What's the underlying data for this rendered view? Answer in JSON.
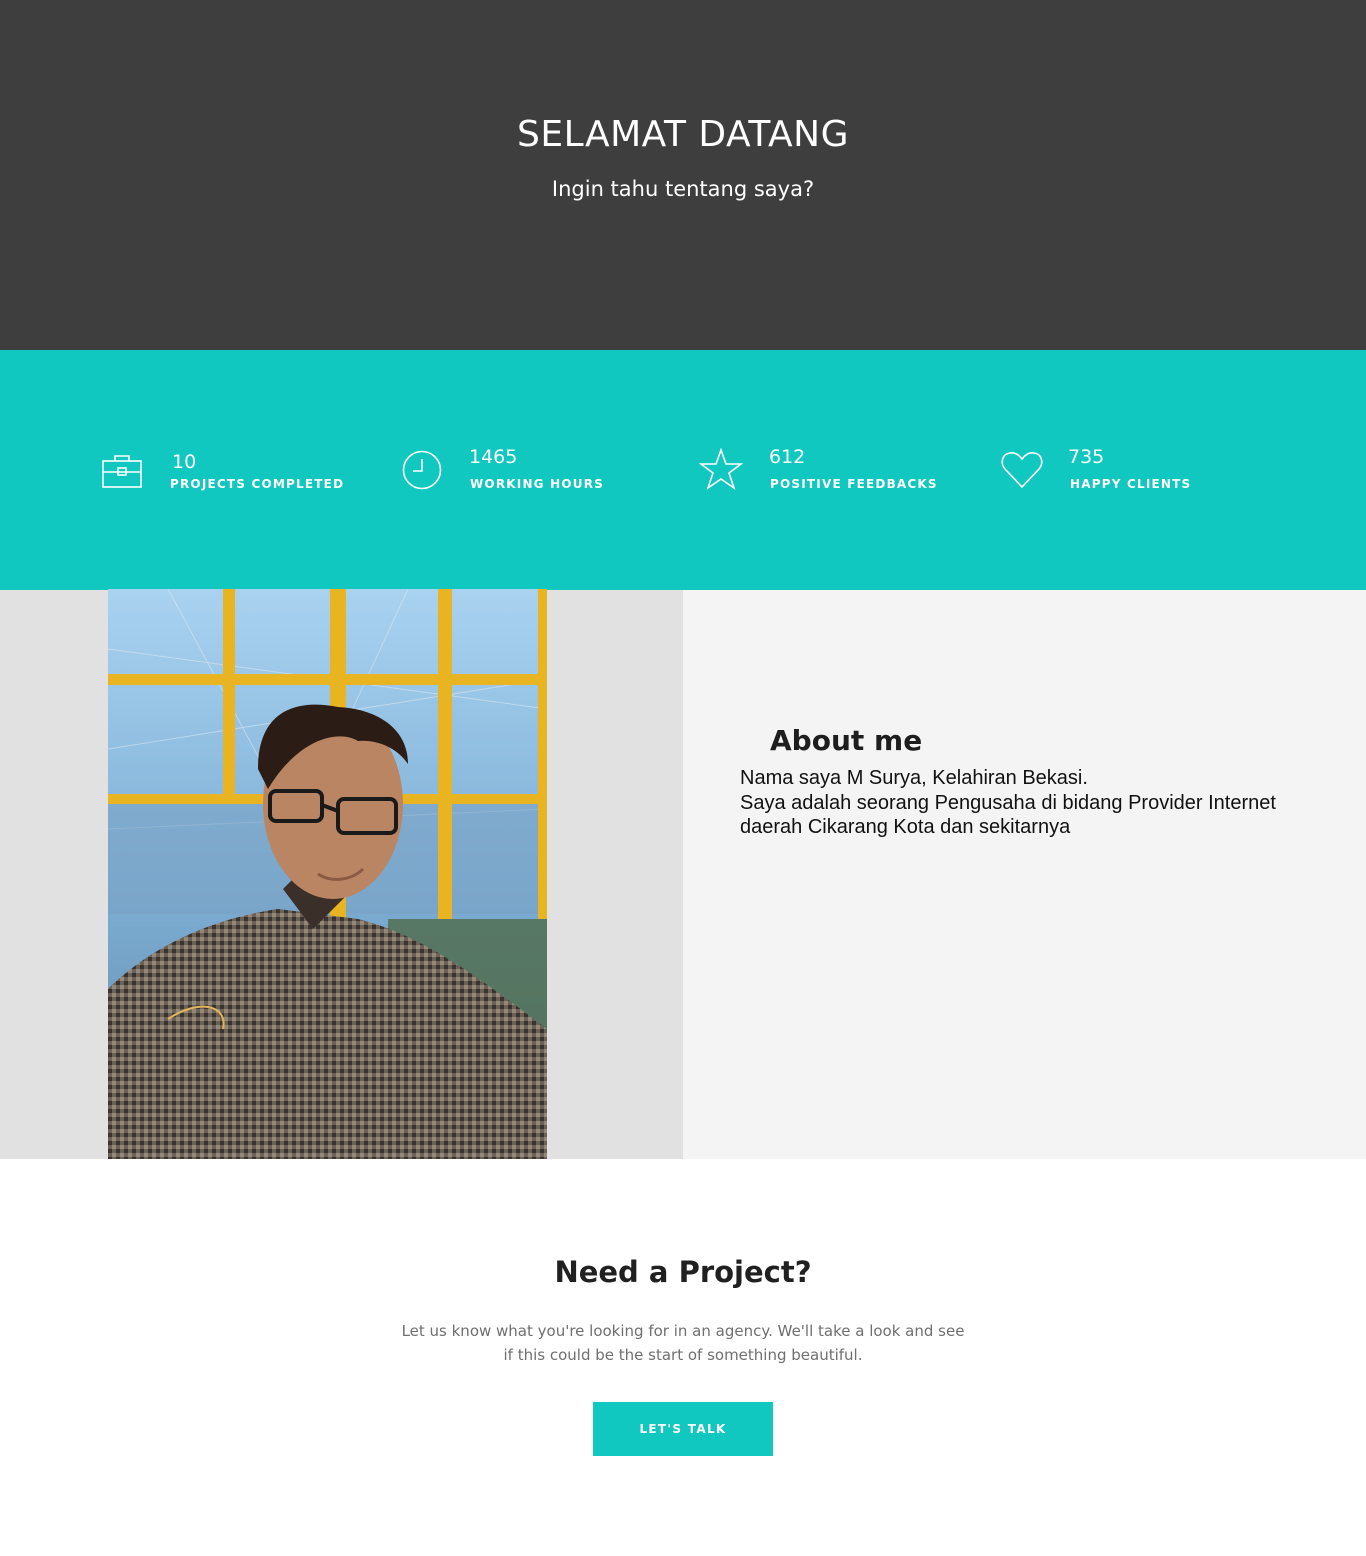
{
  "hero": {
    "title": "SELAMAT DATANG",
    "subtitle": "Ingin tahu tentang saya?"
  },
  "stats": [
    {
      "icon": "briefcase-icon",
      "value": "10",
      "label": "PROJECTS COMPLETED"
    },
    {
      "icon": "clock-icon",
      "value": "1465",
      "label": "WORKING HOURS"
    },
    {
      "icon": "star-icon",
      "value": "612",
      "label": "POSITIVE FEEDBACKS"
    },
    {
      "icon": "heart-icon",
      "value": "735",
      "label": "HAPPY CLIENTS"
    }
  ],
  "about": {
    "title": "About me",
    "lines": [
      "Nama saya M Surya, Kelahiran Bekasi.",
      "Saya adalah seorang Pengusaha di bidang Provider Internet",
      "daerah Cikarang Kota dan sekitarnya"
    ]
  },
  "cta": {
    "title": "Need a Project?",
    "lines": [
      "Let us know what you're looking for in an agency. We'll take a look and see",
      "if this could be the start of something beautiful."
    ],
    "button_label": "LET'S TALK"
  },
  "colors": {
    "hero_bg": "#3e3e3f",
    "accent": "#11c8c1",
    "about_left_bg": "#e1e1e1",
    "about_right_bg": "#f4f4f4"
  }
}
